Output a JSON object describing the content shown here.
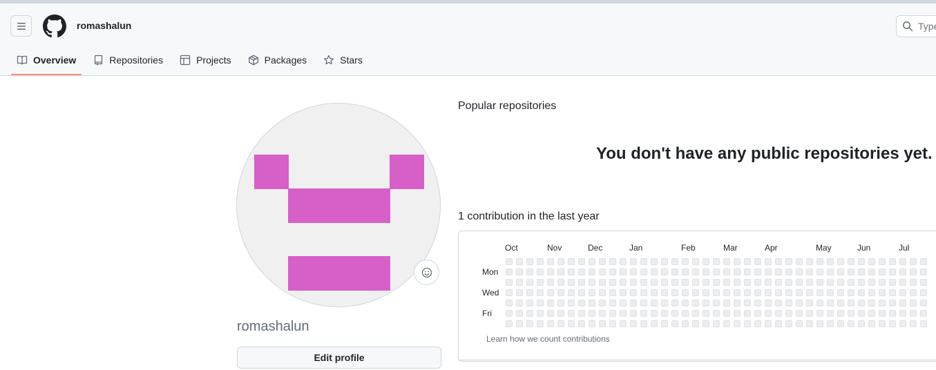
{
  "header": {
    "username": "romashalun",
    "search_placeholder": "Type"
  },
  "tabs": [
    {
      "label": "Overview",
      "icon": "book-icon",
      "active": true
    },
    {
      "label": "Repositories",
      "icon": "repo-icon",
      "active": false
    },
    {
      "label": "Projects",
      "icon": "table-icon",
      "active": false
    },
    {
      "label": "Packages",
      "icon": "package-icon",
      "active": false
    },
    {
      "label": "Stars",
      "icon": "star-icon",
      "active": false
    }
  ],
  "profile": {
    "name": "romashalun",
    "edit_label": "Edit profile",
    "avatar_color": "#d65fc8"
  },
  "popular": {
    "title": "Popular repositories",
    "empty_message": "You don't have any public repositories yet."
  },
  "contributions": {
    "title": "1 contribution in the last year",
    "months": [
      "Oct",
      "Nov",
      "Dec",
      "Jan",
      "Feb",
      "Mar",
      "Apr",
      "May",
      "Jun",
      "Jul"
    ],
    "day_labels": [
      "Mon",
      "Wed",
      "Fri"
    ],
    "learn_link": "Learn how we count contributions",
    "empty_color": "#ebedf0"
  }
}
